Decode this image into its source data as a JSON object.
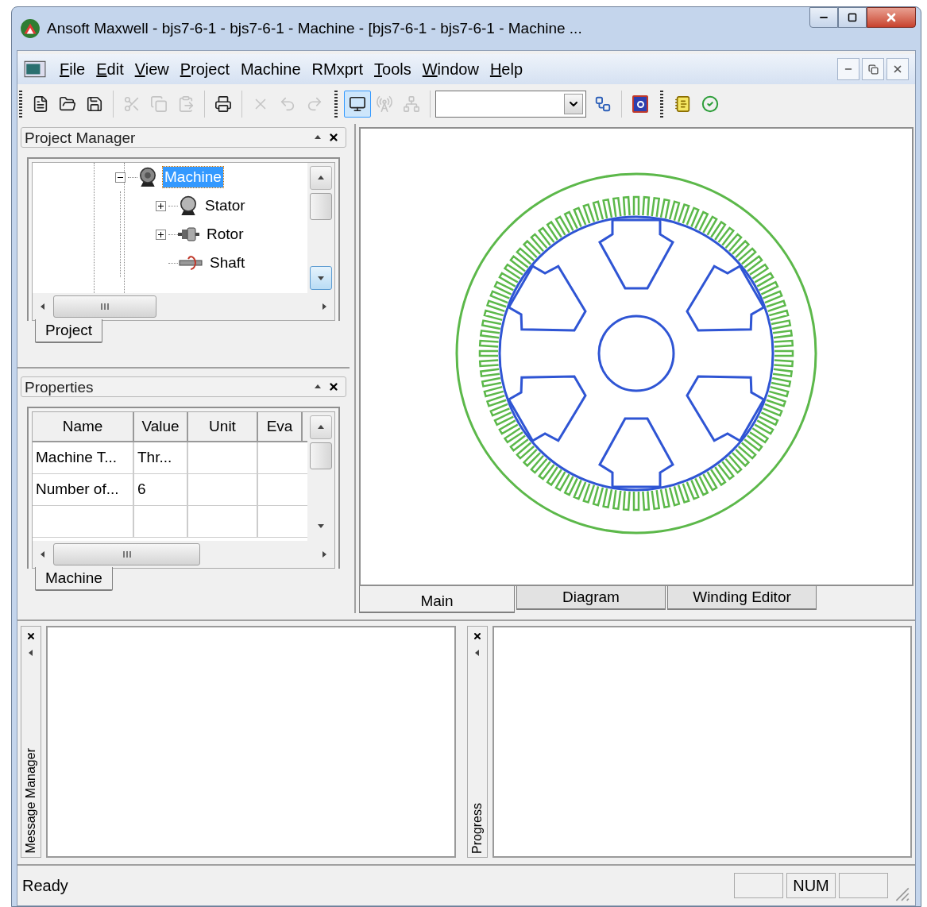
{
  "window": {
    "title": "Ansoft Maxwell  - bjs7-6-1 - bjs7-6-1 - Machine - [bjs7-6-1 - bjs7-6-1 - Machine ..."
  },
  "menu": [
    {
      "label": "File",
      "underline": true
    },
    {
      "label": "Edit",
      "underline": true
    },
    {
      "label": "View",
      "underline": true
    },
    {
      "label": "Project",
      "underline": true
    },
    {
      "label": "Machine",
      "underline": false
    },
    {
      "label": "RMxprt",
      "underline": false
    },
    {
      "label": "Tools",
      "underline": true
    },
    {
      "label": "Window",
      "underline": true
    },
    {
      "label": "Help",
      "underline": true
    }
  ],
  "toolbar": [
    {
      "kind": "new",
      "disabled": false
    },
    {
      "kind": "open",
      "disabled": false
    },
    {
      "kind": "save",
      "disabled": false
    },
    {
      "kind": "sep"
    },
    {
      "kind": "cut",
      "disabled": true
    },
    {
      "kind": "copy",
      "disabled": true
    },
    {
      "kind": "paste",
      "disabled": true
    },
    {
      "kind": "sep"
    },
    {
      "kind": "print",
      "disabled": false
    },
    {
      "kind": "sep"
    },
    {
      "kind": "delete",
      "disabled": true
    },
    {
      "kind": "undo",
      "disabled": true
    },
    {
      "kind": "redo",
      "disabled": true
    },
    {
      "kind": "grip"
    },
    {
      "kind": "monitor",
      "disabled": false,
      "selected": true
    },
    {
      "kind": "antenna",
      "disabled": true,
      "selected": false
    },
    {
      "kind": "network",
      "disabled": true,
      "selected": false
    },
    {
      "kind": "sep"
    },
    {
      "kind": "combo"
    },
    {
      "kind": "hierarchy",
      "disabled": false
    },
    {
      "kind": "sep"
    },
    {
      "kind": "q",
      "disabled": false
    },
    {
      "kind": "grip"
    },
    {
      "kind": "notes",
      "disabled": false
    },
    {
      "kind": "check",
      "disabled": false
    }
  ],
  "project_manager": {
    "title": "Project Manager",
    "tree": [
      {
        "label": "Machine",
        "kind": "machine",
        "selected": true,
        "expanded": true,
        "children": [
          {
            "label": "Stator",
            "kind": "stator",
            "selected": false,
            "expanded": false
          },
          {
            "label": "Rotor",
            "kind": "rotor",
            "selected": false,
            "expanded": false
          },
          {
            "label": "Shaft",
            "kind": "shaft",
            "selected": false
          }
        ]
      }
    ],
    "tabs": [
      {
        "label": "Project",
        "selected": true
      }
    ]
  },
  "properties": {
    "title": "Properties",
    "columns": [
      "Name",
      "Value",
      "Unit",
      "Eva"
    ],
    "rows": [
      {
        "name": "Machine T...",
        "value": "Thr..."
      },
      {
        "name": "Number of...",
        "value": "6"
      }
    ],
    "tabs": [
      {
        "label": "Machine",
        "selected": true
      }
    ]
  },
  "view_tabs": [
    {
      "label": "Main",
      "selected": true
    },
    {
      "label": "Diagram",
      "selected": false
    },
    {
      "label": "Winding Editor",
      "selected": false
    }
  ],
  "bottom_panes": [
    {
      "title": "Message Manager"
    },
    {
      "title": "Progress"
    }
  ],
  "status_bar": {
    "text": "Ready",
    "indicator": "NUM"
  }
}
